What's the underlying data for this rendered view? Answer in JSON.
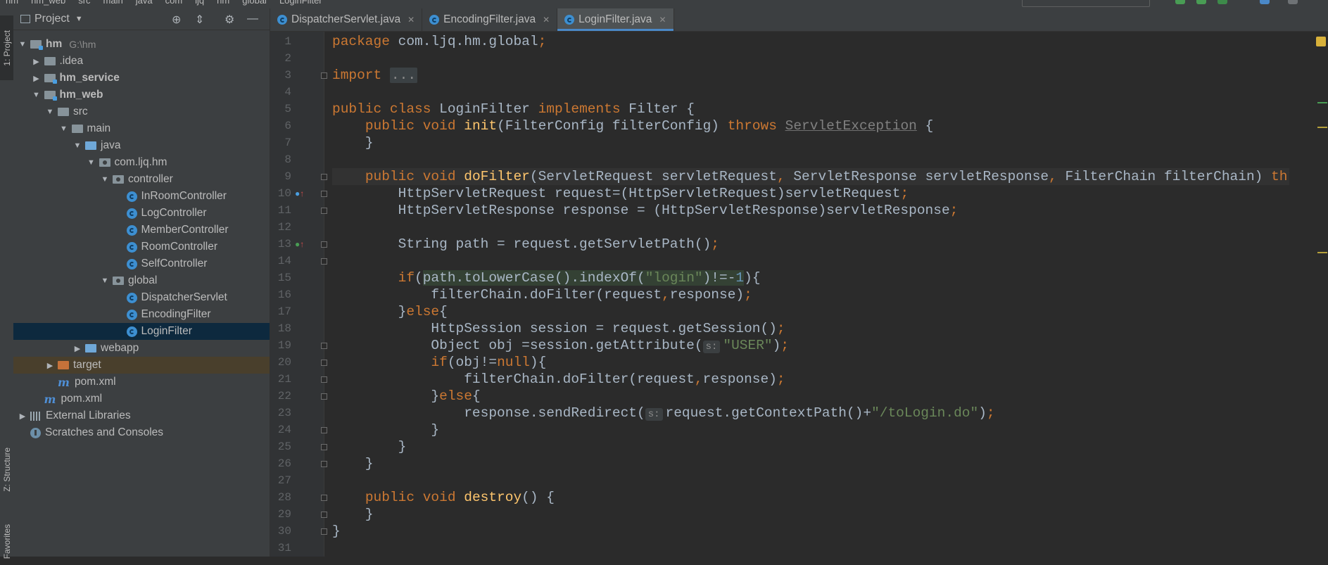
{
  "breadcrumbs": [
    "hm",
    "hm_web",
    "src",
    "main",
    "java",
    "com",
    "ljq",
    "hm",
    "global",
    "LoginFilter"
  ],
  "tool_windows": {
    "project": "1: Project",
    "structure": "Z: Structure",
    "favorites": "Favorites"
  },
  "project_panel": {
    "title": "Project",
    "tree": [
      {
        "label": "hm",
        "suffix": "G:\\hm",
        "depth": 0,
        "arrow": "down",
        "icon": "module-folder",
        "bold": true
      },
      {
        "label": ".idea",
        "depth": 1,
        "arrow": "right",
        "icon": "folder"
      },
      {
        "label": "hm_service",
        "depth": 1,
        "arrow": "right",
        "icon": "module-folder",
        "bold": true
      },
      {
        "label": "hm_web",
        "depth": 1,
        "arrow": "down",
        "icon": "module-folder",
        "bold": true
      },
      {
        "label": "src",
        "depth": 2,
        "arrow": "down",
        "icon": "folder"
      },
      {
        "label": "main",
        "depth": 3,
        "arrow": "down",
        "icon": "folder"
      },
      {
        "label": "java",
        "depth": 4,
        "arrow": "down",
        "icon": "source-folder"
      },
      {
        "label": "com.ljq.hm",
        "depth": 5,
        "arrow": "down",
        "icon": "package"
      },
      {
        "label": "controller",
        "depth": 6,
        "arrow": "down",
        "icon": "package"
      },
      {
        "label": "InRoomController",
        "depth": 7,
        "arrow": "none",
        "icon": "class"
      },
      {
        "label": "LogController",
        "depth": 7,
        "arrow": "none",
        "icon": "class"
      },
      {
        "label": "MemberController",
        "depth": 7,
        "arrow": "none",
        "icon": "class"
      },
      {
        "label": "RoomController",
        "depth": 7,
        "arrow": "none",
        "icon": "class"
      },
      {
        "label": "SelfController",
        "depth": 7,
        "arrow": "none",
        "icon": "class"
      },
      {
        "label": "global",
        "depth": 6,
        "arrow": "down",
        "icon": "package"
      },
      {
        "label": "DispatcherServlet",
        "depth": 7,
        "arrow": "none",
        "icon": "class"
      },
      {
        "label": "EncodingFilter",
        "depth": 7,
        "arrow": "none",
        "icon": "class"
      },
      {
        "label": "LoginFilter",
        "depth": 7,
        "arrow": "none",
        "icon": "class",
        "selected": true
      },
      {
        "label": "webapp",
        "depth": 4,
        "arrow": "right",
        "icon": "web-folder"
      },
      {
        "label": "target",
        "depth": 2,
        "arrow": "right",
        "icon": "excluded-folder",
        "excluded": true
      },
      {
        "label": "pom.xml",
        "depth": 2,
        "arrow": "none",
        "icon": "maven"
      },
      {
        "label": "pom.xml",
        "depth": 1,
        "arrow": "none",
        "icon": "maven"
      },
      {
        "label": "External Libraries",
        "depth": 0,
        "arrow": "right",
        "icon": "libraries"
      },
      {
        "label": "Scratches and Consoles",
        "depth": 0,
        "arrow": "none",
        "icon": "scratches"
      }
    ]
  },
  "editor_tabs": [
    {
      "label": "DispatcherServlet.java",
      "active": false
    },
    {
      "label": "EncodingFilter.java",
      "active": false
    },
    {
      "label": "LoginFilter.java",
      "active": true
    }
  ],
  "code_lines": [
    [
      [
        "kw",
        "package "
      ],
      [
        "",
        "com.ljq.hm.global"
      ],
      [
        "kw",
        ";"
      ]
    ],
    [],
    [
      [
        "kw",
        "import "
      ],
      [
        "fold-txt",
        "..."
      ]
    ],
    [],
    [
      [
        "kw",
        "public class "
      ],
      [
        "",
        "LoginFilter "
      ],
      [
        "kw",
        "implements "
      ],
      [
        "",
        "Filter {"
      ]
    ],
    [
      [
        "",
        "    "
      ],
      [
        "kw",
        "public void "
      ],
      [
        "fn",
        "init"
      ],
      [
        "",
        "(FilterConfig filterConfig) "
      ],
      [
        "kw",
        "throws "
      ],
      [
        "mute",
        "ServletException"
      ],
      [
        "",
        " {"
      ]
    ],
    [
      [
        "",
        "    }"
      ]
    ],
    [],
    [
      [
        "",
        "    "
      ],
      [
        "kw",
        "public void "
      ],
      [
        "fn",
        "doFilter"
      ],
      [
        "",
        "(ServletRequest servletRequest"
      ],
      [
        "kw",
        ", "
      ],
      [
        "",
        "ServletResponse servletResponse"
      ],
      [
        "kw",
        ", "
      ],
      [
        "",
        "FilterChain filterChain) "
      ],
      [
        "kw",
        "thro"
      ]
    ],
    [
      [
        "",
        "        HttpServletRequest request=(HttpServletRequest)servletRequest"
      ],
      [
        "kw",
        ";"
      ]
    ],
    [
      [
        "",
        "        HttpServletResponse response = (HttpServletResponse)servletResponse"
      ],
      [
        "kw",
        ";"
      ]
    ],
    [],
    [
      [
        "",
        "        String path = request.getServletPath()"
      ],
      [
        "kw",
        ";"
      ]
    ],
    [],
    [
      [
        "",
        "        "
      ],
      [
        "kw",
        "if"
      ],
      [
        "",
        "("
      ],
      [
        "hl",
        "path.toLowerCase().indexOf("
      ],
      [
        "str hl",
        "\"login\""
      ],
      [
        "hl",
        ")!=-"
      ],
      [
        "num hl",
        "1"
      ],
      [
        "",
        "){"
      ]
    ],
    [
      [
        "",
        "            filterChain.doFilter(request"
      ],
      [
        "kw",
        ","
      ],
      [
        "",
        "response)"
      ],
      [
        "kw",
        ";"
      ]
    ],
    [
      [
        "",
        "        }"
      ],
      [
        "kw",
        "else"
      ],
      [
        "",
        "{"
      ]
    ],
    [
      [
        "",
        "            HttpSession session = request.getSession()"
      ],
      [
        "kw",
        ";"
      ]
    ],
    [
      [
        "",
        "            Object obj =session.getAttribute("
      ],
      [
        "hint",
        "s:"
      ],
      [
        "str",
        "\"USER\""
      ],
      [
        "",
        ")"
      ],
      [
        "kw",
        ";"
      ]
    ],
    [
      [
        "",
        "            "
      ],
      [
        "kw",
        "if"
      ],
      [
        "",
        "(obj!="
      ],
      [
        "kw",
        "null"
      ],
      [
        "",
        "){"
      ]
    ],
    [
      [
        "",
        "                filterChain.doFilter(request"
      ],
      [
        "kw",
        ","
      ],
      [
        "",
        "response)"
      ],
      [
        "kw",
        ";"
      ]
    ],
    [
      [
        "",
        "            }"
      ],
      [
        "kw",
        "else"
      ],
      [
        "",
        "{"
      ]
    ],
    [
      [
        "",
        "                response.sendRedirect("
      ],
      [
        "hint",
        "s:"
      ],
      [
        "",
        "request.getContextPath()+"
      ],
      [
        "str",
        "\"/toLogin.do\""
      ],
      [
        "",
        ")"
      ],
      [
        "kw",
        ";"
      ]
    ],
    [
      [
        "",
        "            }"
      ]
    ],
    [
      [
        "",
        "        }"
      ]
    ],
    [
      [
        "",
        "    }"
      ]
    ],
    [],
    [
      [
        "",
        "    "
      ],
      [
        "kw",
        "public void "
      ],
      [
        "fn",
        "destroy"
      ],
      [
        "",
        "() {"
      ]
    ],
    [
      [
        "",
        "    }"
      ]
    ],
    [
      [
        "",
        "}"
      ]
    ],
    []
  ],
  "current_line": 9,
  "colors": {
    "keyword": "#cc7832",
    "method": "#ffc66d",
    "string": "#6a8759",
    "number": "#6897bb",
    "text": "#a9b7c6",
    "selection": "#0d293e",
    "accent": "#4a88c7"
  }
}
